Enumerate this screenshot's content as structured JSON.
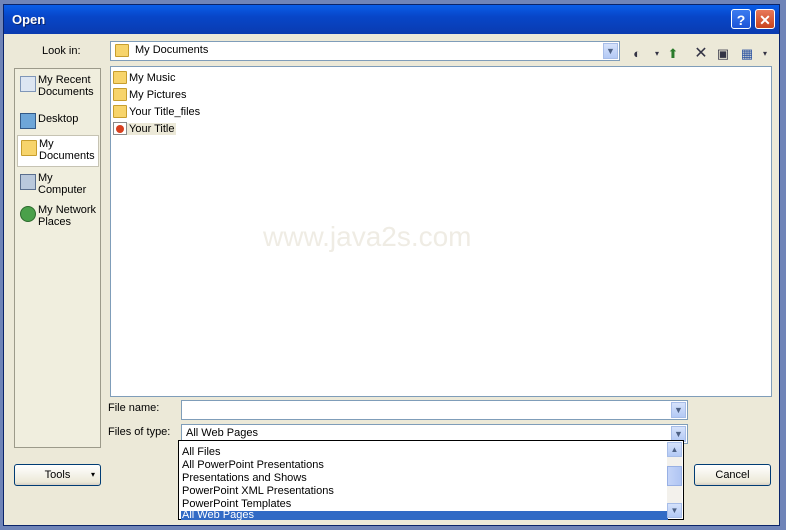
{
  "dialog": {
    "title": "Open"
  },
  "look_in": {
    "label": "Look in:",
    "value": "My Documents"
  },
  "places": [
    {
      "label": "My Recent Documents",
      "icon": "recent-icon"
    },
    {
      "label": "Desktop",
      "icon": "desktop-icon"
    },
    {
      "label": "My Documents",
      "icon": "documents-icon"
    },
    {
      "label": "My Computer",
      "icon": "computer-icon"
    },
    {
      "label": "My Network Places",
      "icon": "network-icon"
    }
  ],
  "files": [
    {
      "name": "My Music"
    },
    {
      "name": "My Pictures"
    },
    {
      "name": "Your Title_files"
    },
    {
      "name": "Your Title"
    }
  ],
  "watermark": "www.java2s.com",
  "file_name": {
    "label": "File name:",
    "value": ""
  },
  "files_of_type": {
    "label": "Files of type:",
    "value": "All Web Pages",
    "options": [
      "All Files",
      "All PowerPoint Presentations",
      "Presentations and Shows",
      "PowerPoint XML Presentations",
      "PowerPoint Templates",
      "All Web Pages"
    ]
  },
  "buttons": {
    "tools": "Tools",
    "cancel": "Cancel"
  }
}
